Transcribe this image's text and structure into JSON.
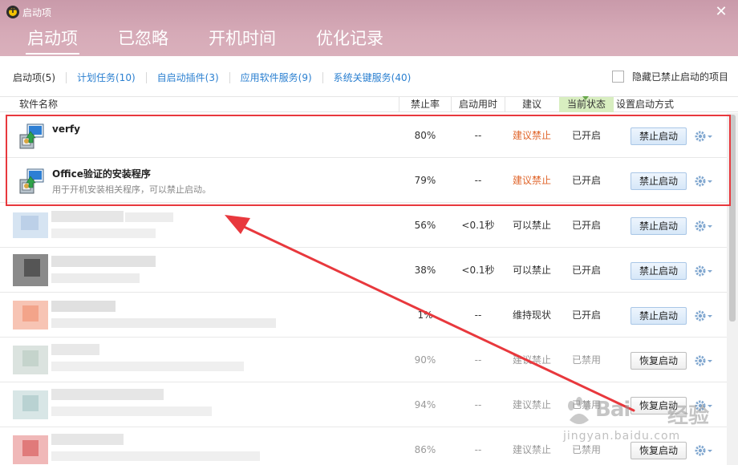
{
  "window": {
    "title": "启动项",
    "close_glyph": "✕"
  },
  "main_tabs": [
    {
      "label": "启动项",
      "active": true
    },
    {
      "label": "已忽略",
      "active": false
    },
    {
      "label": "开机时间",
      "active": false
    },
    {
      "label": "优化记录",
      "active": false
    }
  ],
  "sub_tabs": [
    {
      "label": "启动项(5)",
      "active": true
    },
    {
      "label": "计划任务(10)",
      "active": false
    },
    {
      "label": "自启动插件(3)",
      "active": false
    },
    {
      "label": "应用软件服务(9)",
      "active": false
    },
    {
      "label": "系统关键服务(40)",
      "active": false
    }
  ],
  "hide_disabled": {
    "label": "隐藏已禁止启动的项目",
    "checked": false
  },
  "columns": {
    "name": "软件名称",
    "rate": "禁止率",
    "time": "启动用时",
    "advice": "建议",
    "status": "当前状态",
    "action": "设置启动方式"
  },
  "rows": [
    {
      "name": "verfy",
      "desc": "",
      "rate": "80%",
      "time": "--",
      "advice": "建议禁止",
      "advice_color": "#e0662c",
      "status": "已开启",
      "action": "禁止启动",
      "enabled": true,
      "icon": "installer-icon"
    },
    {
      "name": "Office验证的安装程序",
      "desc": "用于开机安装相关程序，可以禁止启动。",
      "rate": "79%",
      "time": "--",
      "advice": "建议禁止",
      "advice_color": "#e0662c",
      "status": "已开启",
      "action": "禁止启动",
      "enabled": true,
      "icon": "installer-icon"
    },
    {
      "name": "",
      "desc": "",
      "rate": "56%",
      "time": "<0.1秒",
      "advice": "可以禁止",
      "status": "已开启",
      "action": "禁止启动",
      "enabled": true,
      "blurred": true
    },
    {
      "name": "",
      "desc": "",
      "rate": "38%",
      "time": "<0.1秒",
      "advice": "可以禁止",
      "status": "已开启",
      "action": "禁止启动",
      "enabled": true,
      "blurred": true
    },
    {
      "name": "",
      "desc": "",
      "rate": "1%",
      "time": "--",
      "advice": "维持现状",
      "status": "已开启",
      "action": "禁止启动",
      "enabled": true,
      "blurred": true
    },
    {
      "name": "",
      "desc": "",
      "rate": "90%",
      "time": "--",
      "advice": "建议禁止",
      "status": "已禁用",
      "action": "恢复启动",
      "enabled": false,
      "blurred": true
    },
    {
      "name": "",
      "desc": "",
      "rate": "94%",
      "time": "--",
      "advice": "建议禁止",
      "status": "已禁用",
      "action": "恢复启动",
      "enabled": false,
      "blurred": true
    },
    {
      "name": "",
      "desc": "",
      "rate": "86%",
      "time": "--",
      "advice": "建议禁止",
      "status": "已禁用",
      "action": "恢复启动",
      "enabled": false,
      "blurred": true
    }
  ],
  "annotation": {
    "color": "#e8383d"
  },
  "watermark": {
    "brand": "Bai",
    "brand_b": "经验",
    "url": "jingyan.baidu.com"
  },
  "colors": {
    "header": "#d6aab7",
    "link": "#2a7fd0",
    "warn": "#e0662c",
    "status_highlight": "#d8eec0"
  }
}
